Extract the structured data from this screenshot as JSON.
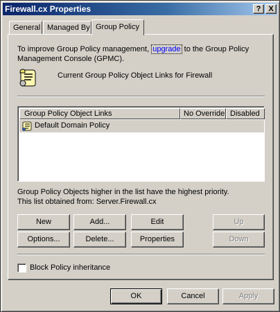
{
  "window": {
    "title": "Firewall.cx Properties",
    "help_glyph": "?",
    "close_glyph": "X"
  },
  "tabs": [
    {
      "label": "General",
      "active": false
    },
    {
      "label": "Managed By",
      "active": false
    },
    {
      "label": "Group Policy",
      "active": true
    }
  ],
  "intro": {
    "text_before": "To improve Group Policy management, ",
    "link": "upgrade",
    "text_after": " to the Group Policy Management Console (GPMC)."
  },
  "current_label": "Current Group Policy Object Links for Firewall",
  "list": {
    "columns": [
      "Group Policy Object Links",
      "No Override",
      "Disabled"
    ],
    "rows": [
      {
        "name": "Default Domain Policy",
        "icon": "gpo-scroll-icon"
      }
    ]
  },
  "note": {
    "line1": "Group Policy Objects higher in the list have the highest priority.",
    "line2": "This list obtained from: Server.Firewall.cx"
  },
  "buttons": {
    "new": "New",
    "add": "Add...",
    "edit": "Edit",
    "up": "Up",
    "options": "Options...",
    "delete": "Delete...",
    "properties": "Properties",
    "down": "Down"
  },
  "block_inheritance": {
    "label": "Block Policy inheritance",
    "checked": false
  },
  "footer": {
    "ok": "OK",
    "cancel": "Cancel",
    "apply": "Apply"
  },
  "colors": {
    "titlebar_start": "#0a246a",
    "titlebar_end": "#a6caf0",
    "face": "#d4d0c8",
    "link": "#0000ff"
  }
}
